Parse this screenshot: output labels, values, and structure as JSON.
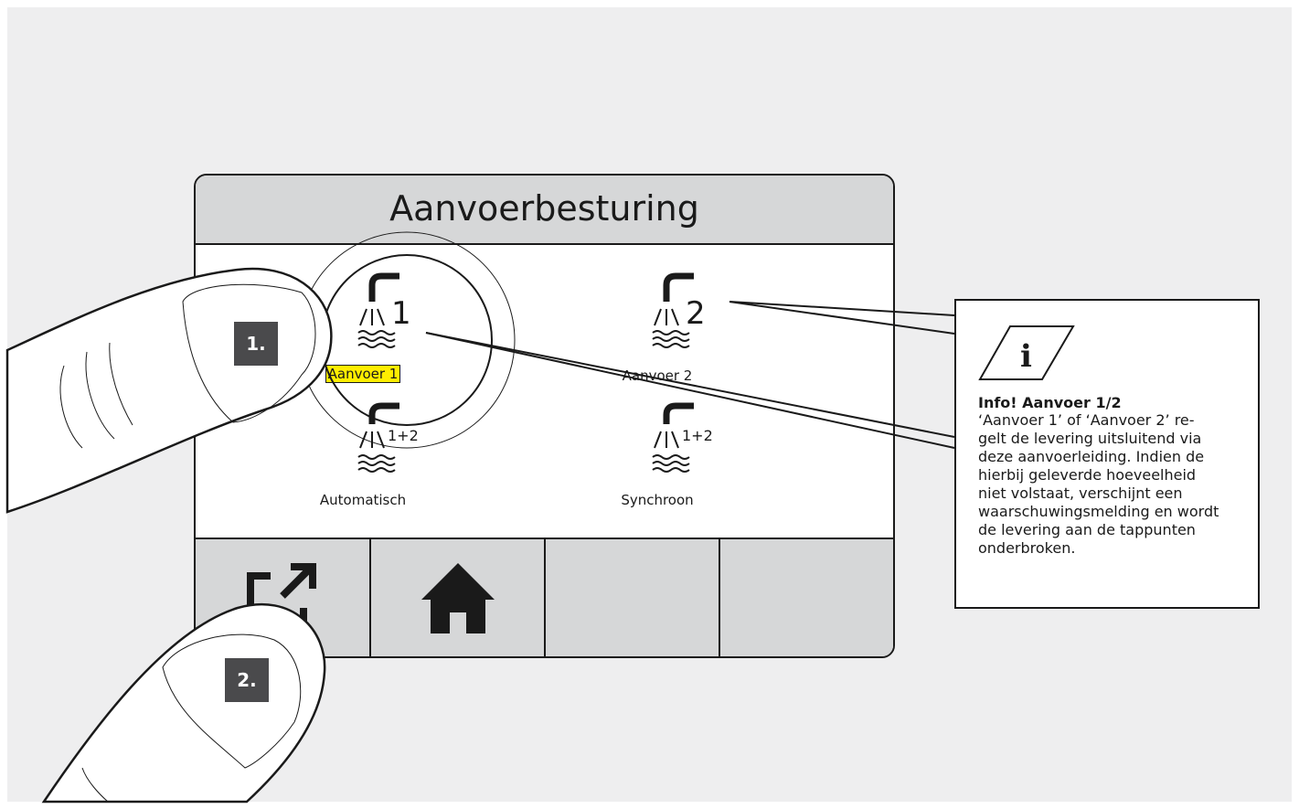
{
  "screen": {
    "title": "Aanvoerbesturing",
    "options": [
      {
        "label": "Aanvoer 1",
        "tag": "1",
        "selected": true,
        "icon": "shower-water-icon"
      },
      {
        "label": "Aanvoer 2",
        "tag": "2",
        "selected": false,
        "icon": "shower-water-icon"
      },
      {
        "label": "Automatisch",
        "tag": "1+2",
        "selected": false,
        "icon": "shower-water-icon"
      },
      {
        "label": "Synchroon",
        "tag": "1+2",
        "selected": false,
        "icon": "shower-water-icon"
      }
    ],
    "nav": [
      {
        "icon": "export-icon"
      },
      {
        "icon": "home-icon"
      },
      {
        "icon": ""
      },
      {
        "icon": ""
      }
    ],
    "highlight_color": "#ffee00"
  },
  "steps": [
    "1.",
    "2."
  ],
  "info": {
    "icon": "info-icon",
    "icon_glyph": "i",
    "heading": "Info! Aanvoer 1/2",
    "lines": [
      "‘Aanvoer 1’ of ‘Aanvoer 2’ re-",
      "gelt de levering uitsluitend via",
      "deze aanvoerleiding. Indien de",
      "hierbij geleverde hoeveelheid",
      "niet volstaat, verschijnt een",
      "waarschuwingsmelding en wordt",
      "de levering aan de tappunten",
      "onderbroken."
    ]
  }
}
